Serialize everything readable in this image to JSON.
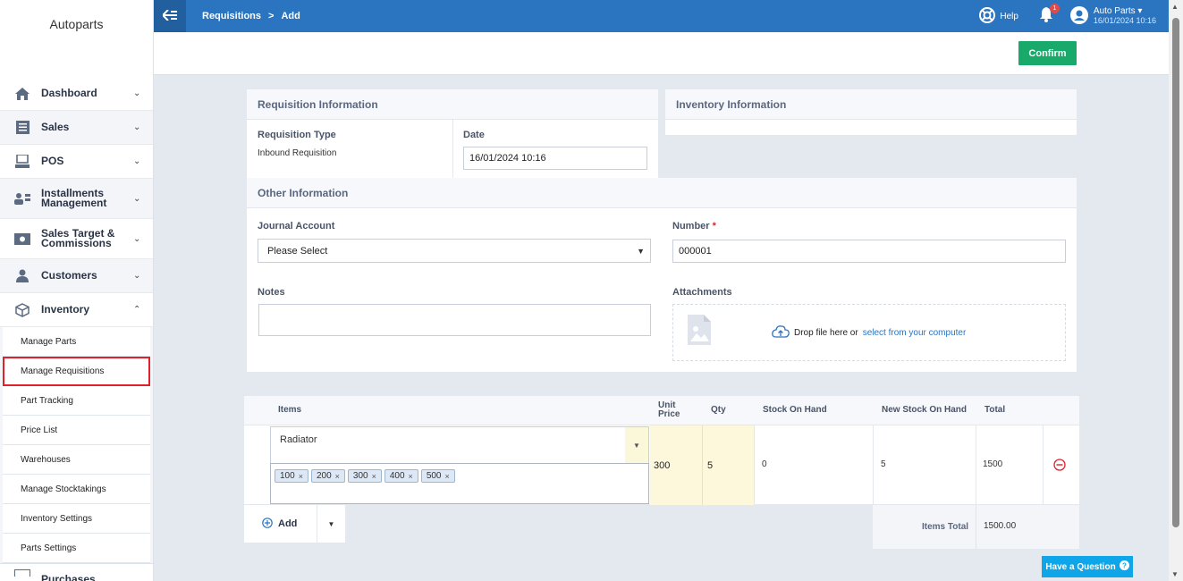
{
  "brand": "Autoparts",
  "sidebar": {
    "items": [
      {
        "label": "Dashboard",
        "icon": "home-icon"
      },
      {
        "label": "Sales",
        "icon": "receipt-icon"
      },
      {
        "label": "POS",
        "icon": "pos-icon"
      },
      {
        "label": "Installments Management",
        "icon": "installments-icon"
      },
      {
        "label": "Sales Target & Commissions",
        "icon": "money-icon"
      },
      {
        "label": "Customers",
        "icon": "user-icon"
      },
      {
        "label": "Inventory",
        "icon": "box-icon"
      }
    ],
    "inventory_sub": [
      "Manage Parts",
      "Manage Requisitions",
      "Part Tracking",
      "Price List",
      "Warehouses",
      "Manage Stocktakings",
      "Inventory Settings",
      "Parts Settings"
    ],
    "next_item": "Purchases"
  },
  "topbar": {
    "crumb_parent": "Requisitions",
    "crumb_sep": ">",
    "crumb_current": "Add",
    "help": "Help",
    "notif_count": "1",
    "user_name": "Auto Parts",
    "user_date": "16/01/2024 10:16"
  },
  "actions": {
    "confirm": "Confirm"
  },
  "requisition": {
    "title": "Requisition Information",
    "type_label": "Requisition Type",
    "type_value": "Inbound Requisition",
    "date_label": "Date",
    "date_value": "16/01/2024 10:16"
  },
  "inventory": {
    "title": "Inventory Information"
  },
  "other": {
    "title": "Other Information",
    "journal_label": "Journal Account",
    "journal_value": "Please Select",
    "number_label": "Number",
    "number_req": "*",
    "number_value": "000001",
    "notes_label": "Notes",
    "attach_label": "Attachments",
    "drop_text": "Drop file here or",
    "drop_link": "select from your computer"
  },
  "table": {
    "headers": {
      "items": "Items",
      "unit_price": "Unit Price",
      "qty": "Qty",
      "stock": "Stock On Hand",
      "new_stock": "New Stock On Hand",
      "total": "Total"
    },
    "row": {
      "item": "Radiator",
      "tags": [
        "100",
        "200",
        "300",
        "400",
        "500"
      ],
      "unit_price": "300",
      "qty": "5",
      "stock": "0",
      "new_stock": "5",
      "total": "1500"
    },
    "add": "Add",
    "items_total_label": "Items Total",
    "items_total_value": "1500.00"
  },
  "help_question": "Have a Question"
}
